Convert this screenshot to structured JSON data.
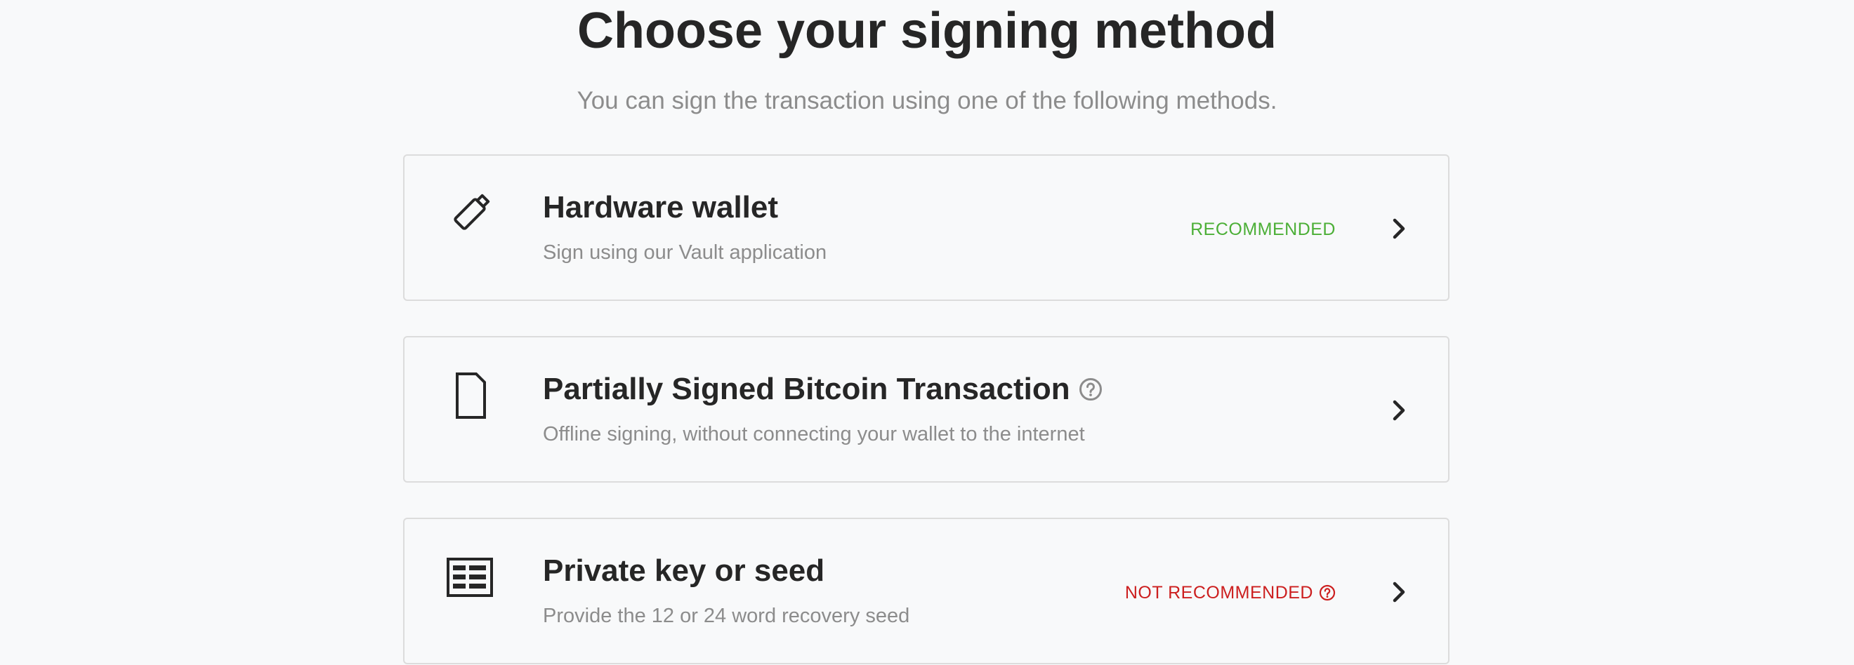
{
  "header": {
    "title": "Choose your signing method",
    "subtitle": "You can sign the transaction using one of the following methods."
  },
  "methods": [
    {
      "icon": "usb-key-icon",
      "title": "Hardware wallet",
      "description": "Sign using our Vault application",
      "badge": "RECOMMENDED",
      "badge_color": "#4caf37"
    },
    {
      "icon": "document-icon",
      "title": "Partially Signed Bitcoin Transaction",
      "description": "Offline signing, without connecting your wallet to the internet",
      "help_icon": "help-circle-icon"
    },
    {
      "icon": "seed-grid-icon",
      "title": "Private key or seed",
      "description": "Provide the 12 or 24 word recovery seed",
      "badge": "NOT RECOMMENDED",
      "badge_color": "#cc1f1f",
      "help_icon": "help-circle-icon"
    }
  ]
}
